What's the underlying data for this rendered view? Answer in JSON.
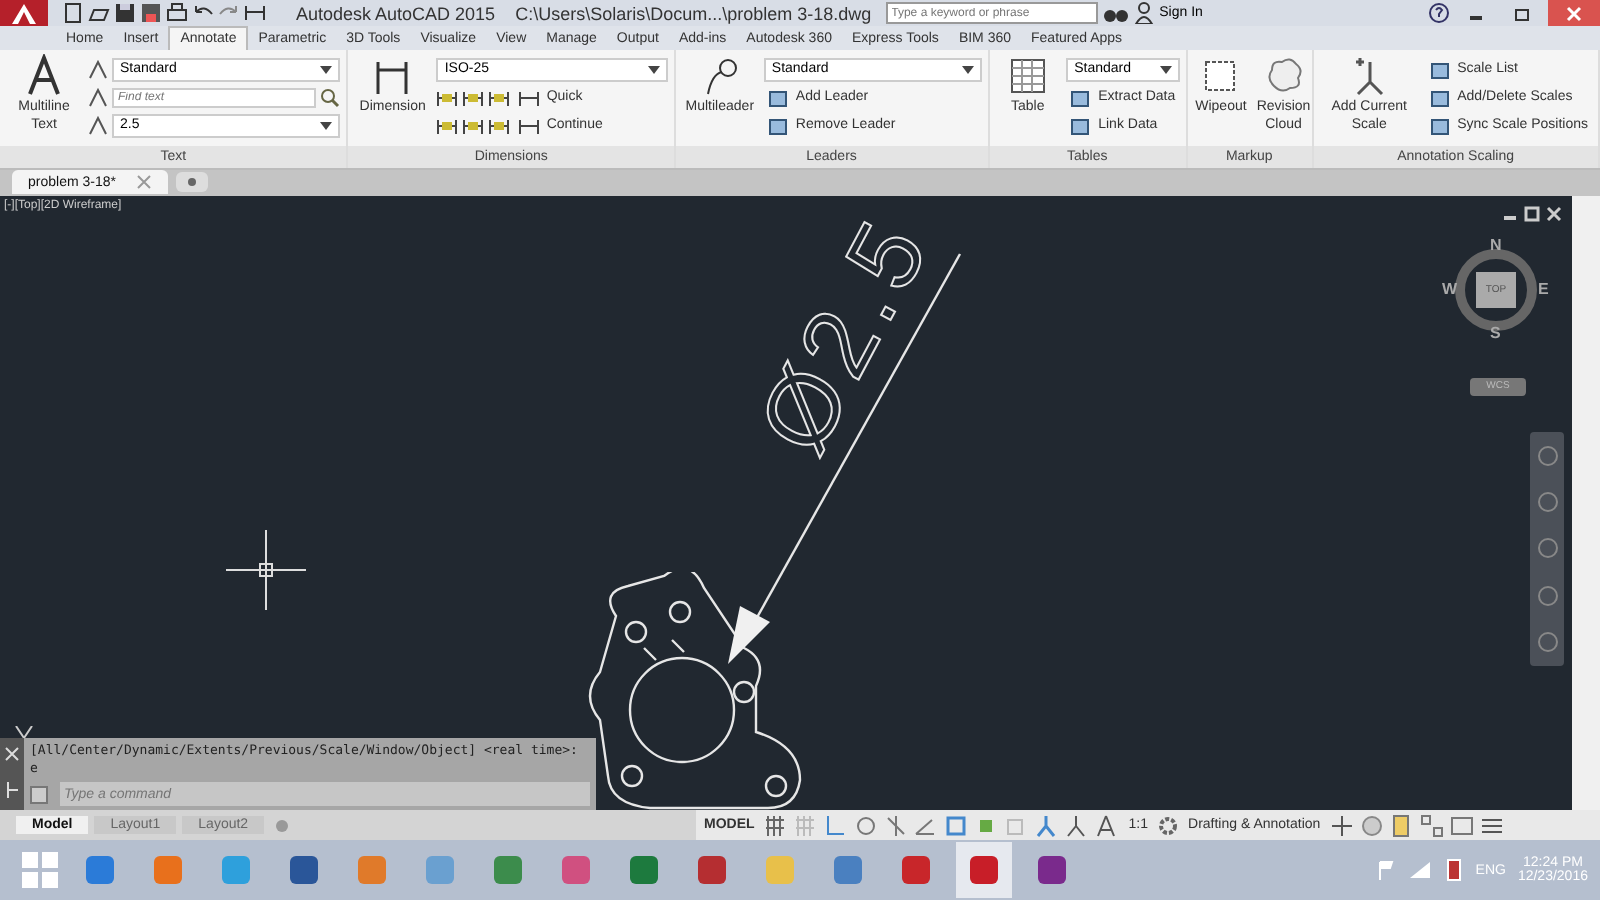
{
  "title_bar": {
    "title": "Autodesk AutoCAD 2015",
    "file_path": "C:\\Users\\Solaris\\Docum...\\problem 3-18.dwg",
    "search_placeholder": "Type a keyword or phrase",
    "sign_in": "Sign In"
  },
  "ribbon_tabs": [
    {
      "label": "Home",
      "selected": false
    },
    {
      "label": "Insert",
      "selected": false
    },
    {
      "label": "Annotate",
      "selected": true
    },
    {
      "label": "Parametric",
      "selected": false
    },
    {
      "label": "3D Tools",
      "selected": false
    },
    {
      "label": "Visualize",
      "selected": false
    },
    {
      "label": "View",
      "selected": false
    },
    {
      "label": "Manage",
      "selected": false
    },
    {
      "label": "Output",
      "selected": false
    },
    {
      "label": "Add-ins",
      "selected": false
    },
    {
      "label": "Autodesk 360",
      "selected": false
    },
    {
      "label": "Express Tools",
      "selected": false
    },
    {
      "label": "BIM 360",
      "selected": false
    },
    {
      "label": "Featured Apps",
      "selected": false
    }
  ],
  "ribbon_panels": [
    {
      "title": "Text",
      "large_buttons": [
        "Multiline Text"
      ],
      "rows": [
        {
          "kind": "dropdown",
          "value": "Standard"
        },
        {
          "kind": "search",
          "placeholder": "Find text"
        },
        {
          "kind": "dropdown",
          "value": "2.5"
        }
      ]
    },
    {
      "title": "Dimensions",
      "large_buttons": [
        "Dimension"
      ],
      "rows": [
        {
          "kind": "dropdown",
          "value": "ISO-25"
        },
        {
          "kind": "tool_row",
          "label": "Quick"
        },
        {
          "kind": "tool_row",
          "label": "Continue"
        }
      ]
    },
    {
      "title": "Leaders",
      "large_buttons": [
        "Multileader"
      ],
      "rows": [
        {
          "kind": "dropdown",
          "value": "Standard"
        },
        {
          "kind": "button",
          "label": "Add Leader"
        },
        {
          "kind": "button",
          "label": "Remove Leader"
        }
      ]
    },
    {
      "title": "Tables",
      "large_buttons": [
        "Table"
      ],
      "rows": [
        {
          "kind": "dropdown",
          "value": "Standard"
        },
        {
          "kind": "button",
          "label": "Extract Data"
        },
        {
          "kind": "button",
          "label": "Link Data"
        }
      ]
    },
    {
      "title": "Markup",
      "large_buttons": [
        "Wipeout",
        "Revision Cloud"
      ]
    },
    {
      "title": "Annotation Scaling",
      "large_buttons": [
        "Add Current Scale"
      ],
      "rows": [
        {
          "kind": "button",
          "label": "Scale List"
        },
        {
          "kind": "button",
          "label": "Add/Delete Scales"
        },
        {
          "kind": "button",
          "label": "Sync Scale Positions"
        }
      ]
    }
  ],
  "file_tabs": [
    {
      "label": "problem 3-18*",
      "selected": true
    }
  ],
  "viewport": {
    "label": "[-][Top][2D Wireframe]",
    "dimension_text": "Ø2.5",
    "viewcube": {
      "north": "N",
      "west": "W",
      "east": "E",
      "south": "S",
      "face": "TOP",
      "ucs": "WCS"
    }
  },
  "command_line": {
    "history": "[All/Center/Dynamic/Extents/Previous/Scale/Window/Object] <real time>: e",
    "placeholder": "Type a command"
  },
  "layout_tabs": [
    {
      "label": "Model",
      "selected": true
    },
    {
      "label": "Layout1",
      "selected": false
    },
    {
      "label": "Layout2",
      "selected": false
    }
  ],
  "status_bar": {
    "space": "MODEL",
    "scale": "1:1",
    "workspace": "Drafting & Annotation"
  },
  "taskbar": {
    "language": "ENG",
    "time": "12:24 PM",
    "date": "12/23/2016"
  }
}
